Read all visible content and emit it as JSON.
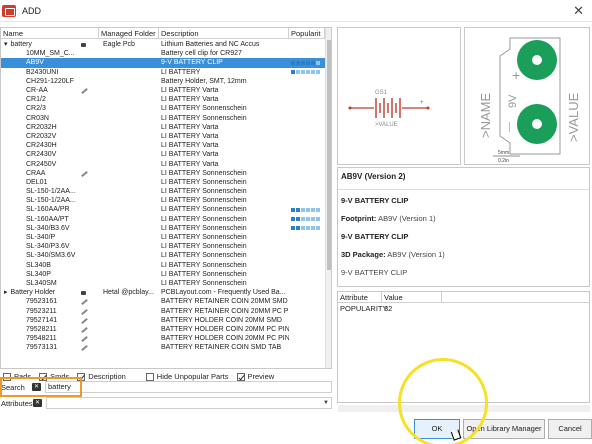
{
  "window": {
    "title": "ADD"
  },
  "columns": {
    "name": "Name",
    "folder": "Managed Folder",
    "description": "Description",
    "popularity": "Popularit"
  },
  "rows": [
    {
      "indent": 0,
      "expander": "▾",
      "name": "battery",
      "lock": true,
      "folder": "Eagle Pcb",
      "desc": "Lithium Batteries and NC Accus",
      "pop": 0
    },
    {
      "indent": 2,
      "expander": "",
      "name": "10MM_SM_C...",
      "lock": false,
      "folder": "",
      "desc": "Battery cell clip for CR927",
      "pop": 0
    },
    {
      "indent": 2,
      "expander": "",
      "name": "AB9V",
      "lock": false,
      "folder": "",
      "desc": "9-V BATTERY CLIP",
      "pop": 5,
      "selected": true
    },
    {
      "indent": 2,
      "expander": "",
      "name": "B2430UNI",
      "lock": false,
      "folder": "",
      "desc": "LI BATTERY",
      "pop": 1
    },
    {
      "indent": 2,
      "expander": "",
      "name": "CH291-1220LF",
      "lock": false,
      "folder": "",
      "desc": "Battery Holder, SMT, 12mm",
      "pop": 0
    },
    {
      "indent": 2,
      "expander": "",
      "name": "CR-AA",
      "lock": false,
      "pencil": true,
      "folder": "",
      "desc": "LI BATTERY Varta",
      "pop": 0
    },
    {
      "indent": 2,
      "expander": "",
      "name": "CR1/2",
      "lock": false,
      "folder": "",
      "desc": "LI BATTERY Varta",
      "pop": 0
    },
    {
      "indent": 2,
      "expander": "",
      "name": "CR2/3",
      "lock": false,
      "folder": "",
      "desc": "LI BATTERY Sonnenschein",
      "pop": 0
    },
    {
      "indent": 2,
      "expander": "",
      "name": "CR03N",
      "lock": false,
      "folder": "",
      "desc": "LI BATTERY Sonnenschein",
      "pop": 0
    },
    {
      "indent": 2,
      "expander": "",
      "name": "CR2032H",
      "lock": false,
      "folder": "",
      "desc": "LI BATTERY Varta",
      "pop": 0
    },
    {
      "indent": 2,
      "expander": "",
      "name": "CR2032V",
      "lock": false,
      "folder": "",
      "desc": "LI BATTERY Varta",
      "pop": 0
    },
    {
      "indent": 2,
      "expander": "",
      "name": "CR2430H",
      "lock": false,
      "folder": "",
      "desc": "LI BATTERY Varta",
      "pop": 0
    },
    {
      "indent": 2,
      "expander": "",
      "name": "CR2430V",
      "lock": false,
      "folder": "",
      "desc": "LI BATTERY Varta",
      "pop": 0
    },
    {
      "indent": 2,
      "expander": "",
      "name": "CR2450V",
      "lock": false,
      "folder": "",
      "desc": "LI BATTERY Varta",
      "pop": 0
    },
    {
      "indent": 2,
      "expander": "",
      "name": "CRAA",
      "lock": false,
      "pencil": true,
      "folder": "",
      "desc": "LI BATTERY Sonnenschein",
      "pop": 0
    },
    {
      "indent": 2,
      "expander": "",
      "name": "DEL01",
      "lock": false,
      "folder": "",
      "desc": "LI BATTERY Sonnenschein",
      "pop": 0
    },
    {
      "indent": 2,
      "expander": "",
      "name": "SL-150-1/2AA...",
      "lock": false,
      "folder": "",
      "desc": "LI BATTERY Sonnenschein",
      "pop": 0
    },
    {
      "indent": 2,
      "expander": "",
      "name": "SL-150-1/2AA...",
      "lock": false,
      "folder": "",
      "desc": "LI BATTERY Sonnenschein",
      "pop": 0
    },
    {
      "indent": 2,
      "expander": "",
      "name": "SL-160AA/PR",
      "lock": false,
      "folder": "",
      "desc": "LI BATTERY Sonnenschein",
      "pop": 2
    },
    {
      "indent": 2,
      "expander": "",
      "name": "SL-160AA/PT",
      "lock": false,
      "folder": "",
      "desc": "LI BATTERY Sonnenschein",
      "pop": 2
    },
    {
      "indent": 2,
      "expander": "",
      "name": "SL-340/B3.6V",
      "lock": false,
      "folder": "",
      "desc": "LI BATTERY Sonnenschein",
      "pop": 2
    },
    {
      "indent": 2,
      "expander": "",
      "name": "SL-340/P",
      "lock": false,
      "folder": "",
      "desc": "LI BATTERY Sonnenschein",
      "pop": 0
    },
    {
      "indent": 2,
      "expander": "",
      "name": "SL-340/P3.6V",
      "lock": false,
      "folder": "",
      "desc": "LI BATTERY Sonnenschein",
      "pop": 0
    },
    {
      "indent": 2,
      "expander": "",
      "name": "SL-340/SM3.6V",
      "lock": false,
      "folder": "",
      "desc": "LI BATTERY Sonnenschein",
      "pop": 0
    },
    {
      "indent": 2,
      "expander": "",
      "name": "SL340B",
      "lock": false,
      "folder": "",
      "desc": "LI BATTERY Sonnenschein",
      "pop": 0
    },
    {
      "indent": 2,
      "expander": "",
      "name": "SL340P",
      "lock": false,
      "folder": "",
      "desc": "LI BATTERY Sonnenschein",
      "pop": 0
    },
    {
      "indent": 2,
      "expander": "",
      "name": "SL340SM",
      "lock": false,
      "folder": "",
      "desc": "LI BATTERY Sonnenschein",
      "pop": 0
    },
    {
      "indent": 0,
      "expander": "▸",
      "name": "Battery Holder",
      "lock": true,
      "folder": "Hetal @pcblay...",
      "desc": "PCBLayout.com - Frequently Used Ba...",
      "pop": 0
    },
    {
      "indent": 2,
      "expander": "",
      "name": "79523161",
      "lock": false,
      "pencil": true,
      "folder": "",
      "desc": "BATTERY RETAINER COIN 20MM SMD",
      "pop": 0
    },
    {
      "indent": 2,
      "expander": "",
      "name": "79523211",
      "lock": false,
      "pencil": true,
      "folder": "",
      "desc": "BATTERY RETAINER COIN 20MM PC PIN",
      "pop": 0
    },
    {
      "indent": 2,
      "expander": "",
      "name": "79527141",
      "lock": false,
      "pencil": true,
      "folder": "",
      "desc": "BATTERY HOLDER COIN 20MM SMD",
      "pop": 0
    },
    {
      "indent": 2,
      "expander": "",
      "name": "79528211",
      "lock": false,
      "pencil": true,
      "folder": "",
      "desc": "BATTERY HOLDER COIN 20MM PC PIN",
      "pop": 0
    },
    {
      "indent": 2,
      "expander": "",
      "name": "79548211",
      "lock": false,
      "pencil": true,
      "folder": "",
      "desc": "BATTERY HOLDER COIN 20MM PC PIN",
      "pop": 0
    },
    {
      "indent": 2,
      "expander": "",
      "name": "79573131",
      "lock": false,
      "pencil": true,
      "folder": "",
      "desc": "BATTERY RETAINER COIN SMD TAB",
      "pop": 0
    }
  ],
  "options": {
    "pads": "Pads",
    "smds": "Smds",
    "description": "Description",
    "hide_unpopular": "Hide Unpopular Parts",
    "preview": "Preview"
  },
  "search": {
    "label": "Search",
    "value": "battery"
  },
  "attributes": {
    "label": "Attributes"
  },
  "symbol_preview": {
    "ref": "GS1",
    "value_label": ">VALUE",
    "plus": "+"
  },
  "footprint_preview": {
    "name_label": ">NAME",
    "value_label": ">VALUE",
    "voltage": "9V",
    "plus": "+",
    "minus": "—",
    "scale_mm": "5mm",
    "scale_in": "0.2in"
  },
  "info": {
    "heading": "AB9V (Version 2)",
    "device_desc": "9-V BATTERY CLIP",
    "footprint_label": "Footprint:",
    "footprint_value": "AB9V (Version 1)",
    "footprint_desc": "9-V BATTERY CLIP",
    "package_label": "3D Package:",
    "package_value": "AB9V (Version 1)",
    "package_desc": "9-V BATTERY CLIP"
  },
  "attr_table": {
    "col_attribute": "Attribute",
    "col_value": "Value",
    "rows": [
      {
        "attribute": "POPULARITY",
        "value": "32"
      }
    ]
  },
  "buttons": {
    "ok": "OK",
    "open_library_manager": "Open Library Manager",
    "cancel": "Cancel"
  }
}
